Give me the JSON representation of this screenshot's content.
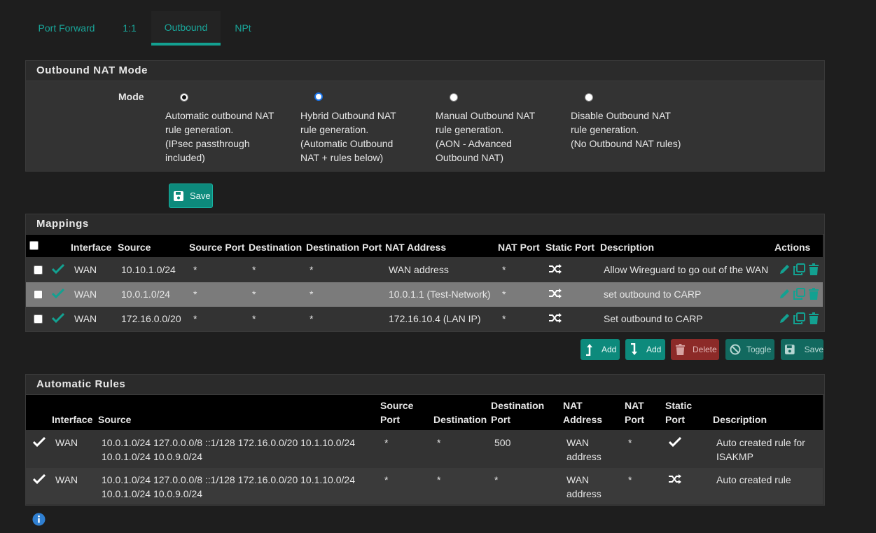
{
  "tabs": [
    {
      "label": "Port Forward",
      "active": false
    },
    {
      "label": "1:1",
      "active": false
    },
    {
      "label": "Outbound",
      "active": true
    },
    {
      "label": "NPt",
      "active": false
    }
  ],
  "mode_panel": {
    "title": "Outbound NAT Mode",
    "mode_label": "Mode",
    "options": [
      {
        "lines": [
          "Automatic outbound NAT",
          "rule generation.",
          "(IPsec passthrough",
          "included)"
        ],
        "checked": true
      },
      {
        "lines": [
          "Hybrid Outbound NAT",
          "rule generation.",
          "(Automatic Outbound",
          "NAT + rules below)"
        ],
        "checked": false
      },
      {
        "lines": [
          "Manual Outbound NAT",
          "rule generation.",
          "(AON - Advanced",
          "Outbound NAT)"
        ],
        "checked": false
      },
      {
        "lines": [
          "Disable Outbound NAT",
          "rule generation.",
          "(No Outbound NAT rules)"
        ],
        "checked": false
      }
    ],
    "save_label": "Save"
  },
  "mappings": {
    "title": "Mappings",
    "headers": [
      "Interface",
      "Source",
      "Source Port",
      "Destination",
      "Destination Port",
      "NAT Address",
      "NAT Port",
      "Static Port",
      "Description",
      "Actions"
    ],
    "rows": [
      {
        "interface": "WAN",
        "source": "10.10.1.0/24",
        "source_port": "*",
        "destination": "*",
        "destination_port": "*",
        "nat_address": "WAN address",
        "nat_port": "*",
        "static_port": "shuffle-icon",
        "description": "Allow Wireguard to go out of the WAN"
      },
      {
        "interface": "WAN",
        "source": "10.0.1.0/24",
        "source_port": "*",
        "destination": "*",
        "destination_port": "*",
        "nat_address": "10.0.1.1 (Test-Network)",
        "nat_port": "*",
        "static_port": "shuffle-icon",
        "description": "set outbound to CARP"
      },
      {
        "interface": "WAN",
        "source": "172.16.0.0/20",
        "source_port": "*",
        "destination": "*",
        "destination_port": "*",
        "nat_address": "172.16.10.4 (LAN IP)",
        "nat_port": "*",
        "static_port": "shuffle-icon",
        "description": "Set outbound to CARP"
      }
    ],
    "buttons": {
      "add_top": "Add",
      "add_bottom": "Add",
      "delete": "Delete",
      "toggle": "Toggle",
      "save": "Save"
    }
  },
  "auto_rules": {
    "title": "Automatic Rules",
    "headers": {
      "interface": "Interface",
      "source": "Source",
      "source_port": [
        "Source",
        "Port"
      ],
      "destination": "Destination",
      "destination_port": [
        "Destination",
        "Port"
      ],
      "nat_address": [
        "NAT",
        "Address"
      ],
      "nat_port": [
        "NAT",
        "Port"
      ],
      "static_port": [
        "Static",
        "Port"
      ],
      "description": "Description"
    },
    "rows": [
      {
        "interface": "WAN",
        "source": [
          "10.0.1.0/24 127.0.0.0/8 ::1/128 172.16.0.0/20 10.1.10.0/24",
          "10.0.1.0/24 10.0.9.0/24"
        ],
        "source_port": "*",
        "destination": "*",
        "destination_port": "500",
        "nat_address": [
          "WAN",
          "address"
        ],
        "nat_port": "*",
        "static_port": "check-icon",
        "description": [
          "Auto created rule for",
          "ISAKMP"
        ]
      },
      {
        "interface": "WAN",
        "source": [
          "10.0.1.0/24 127.0.0.0/8 ::1/128 172.16.0.0/20 10.1.10.0/24",
          "10.0.1.0/24 10.0.9.0/24"
        ],
        "source_port": "*",
        "destination": "*",
        "destination_port": "*",
        "nat_address": [
          "WAN",
          "address"
        ],
        "nat_port": "*",
        "static_port": "shuffle-icon",
        "description": [
          "Auto created rule"
        ]
      }
    ]
  },
  "colors": {
    "accent": "#13a191",
    "background": "#1e1e1e",
    "panel": "#333333",
    "danger": "#8c2a28",
    "info": "#1a73e8"
  }
}
